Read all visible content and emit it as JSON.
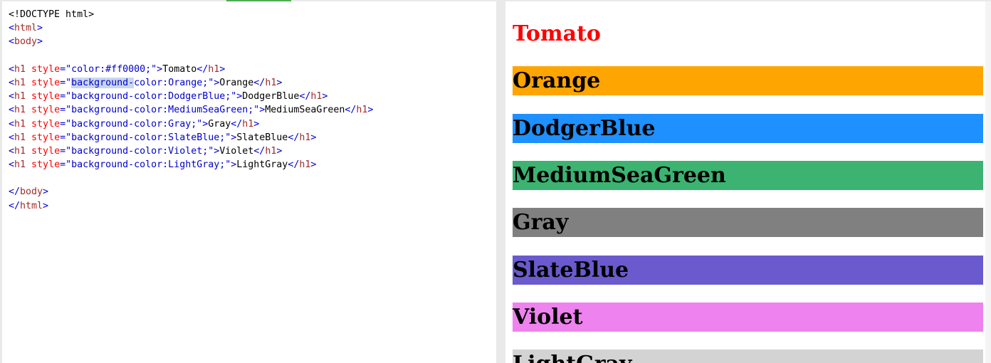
{
  "editor": {
    "lines": [
      {
        "doctype": "<!DOCTYPE html>"
      },
      {
        "tag": "html"
      },
      {
        "tag": "body"
      },
      {},
      {
        "h1": true,
        "attr": "style",
        "val": "color:#ff0000;",
        "text": "Tomato"
      },
      {
        "h1": true,
        "attr": "style",
        "val": "background-color:Orange;",
        "text": "Orange",
        "selected": "background-"
      },
      {
        "h1": true,
        "attr": "style",
        "val": "background-color:DodgerBlue;",
        "text": "DodgerBlue"
      },
      {
        "h1": true,
        "attr": "style",
        "val": "background-color:MediumSeaGreen;",
        "text": "MediumSeaGreen"
      },
      {
        "h1": true,
        "attr": "style",
        "val": "background-color:Gray;",
        "text": "Gray"
      },
      {
        "h1": true,
        "attr": "style",
        "val": "background-color:SlateBlue;",
        "text": "SlateBlue"
      },
      {
        "h1": true,
        "attr": "style",
        "val": "background-color:Violet;",
        "text": "Violet"
      },
      {
        "h1": true,
        "attr": "style",
        "val": "background-color:LightGray;",
        "text": "LightGray"
      },
      {},
      {
        "closetag": "body"
      },
      {
        "closetag": "html"
      }
    ]
  },
  "preview": {
    "headings": [
      {
        "text": "Tomato",
        "color": "#ff0000",
        "bg": ""
      },
      {
        "text": "Orange",
        "color": "#000000",
        "bg": "#ffa500"
      },
      {
        "text": "DodgerBlue",
        "color": "#000000",
        "bg": "#1e90ff"
      },
      {
        "text": "MediumSeaGreen",
        "color": "#000000",
        "bg": "#3cb371"
      },
      {
        "text": "Gray",
        "color": "#000000",
        "bg": "#808080"
      },
      {
        "text": "SlateBlue",
        "color": "#000000",
        "bg": "#6a5acd"
      },
      {
        "text": "Violet",
        "color": "#000000",
        "bg": "#ee82ee"
      },
      {
        "text": "LightGray",
        "color": "#000000",
        "bg": "#d3d3d3"
      }
    ]
  }
}
